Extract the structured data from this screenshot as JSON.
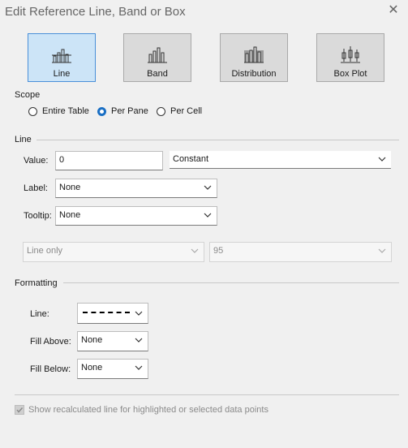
{
  "window": {
    "title": "Edit Reference Line, Band or Box",
    "close_glyph": "✕"
  },
  "types": [
    {
      "label": "Line",
      "icon": "line-icon",
      "selected": true
    },
    {
      "label": "Band",
      "icon": "band-icon",
      "selected": false
    },
    {
      "label": "Distribution",
      "icon": "distribution-icon",
      "selected": false
    },
    {
      "label": "Box Plot",
      "icon": "box-plot-icon",
      "selected": false
    }
  ],
  "scope": {
    "heading": "Scope",
    "options": [
      "Entire Table",
      "Per Pane",
      "Per Cell"
    ],
    "selected": "Per Pane"
  },
  "line_section": {
    "heading": "Line",
    "value_label": "Value:",
    "value": "0",
    "value_type": "Constant",
    "label_label": "Label:",
    "label_value": "None",
    "tooltip_label": "Tooltip:",
    "tooltip_value": "None",
    "ci_type": "Line only",
    "ci_level": "95"
  },
  "formatting": {
    "heading": "Formatting",
    "line_label": "Line:",
    "fill_above_label": "Fill Above:",
    "fill_above_value": "None",
    "fill_below_label": "Fill Below:",
    "fill_below_value": "None"
  },
  "recalc": {
    "label": "Show recalculated line for highlighted or selected data points",
    "checked": true,
    "enabled": false
  },
  "colors": {
    "accent": "#1a6fc4",
    "selected_bg": "#cce4f7",
    "selected_border": "#4a90d9"
  }
}
